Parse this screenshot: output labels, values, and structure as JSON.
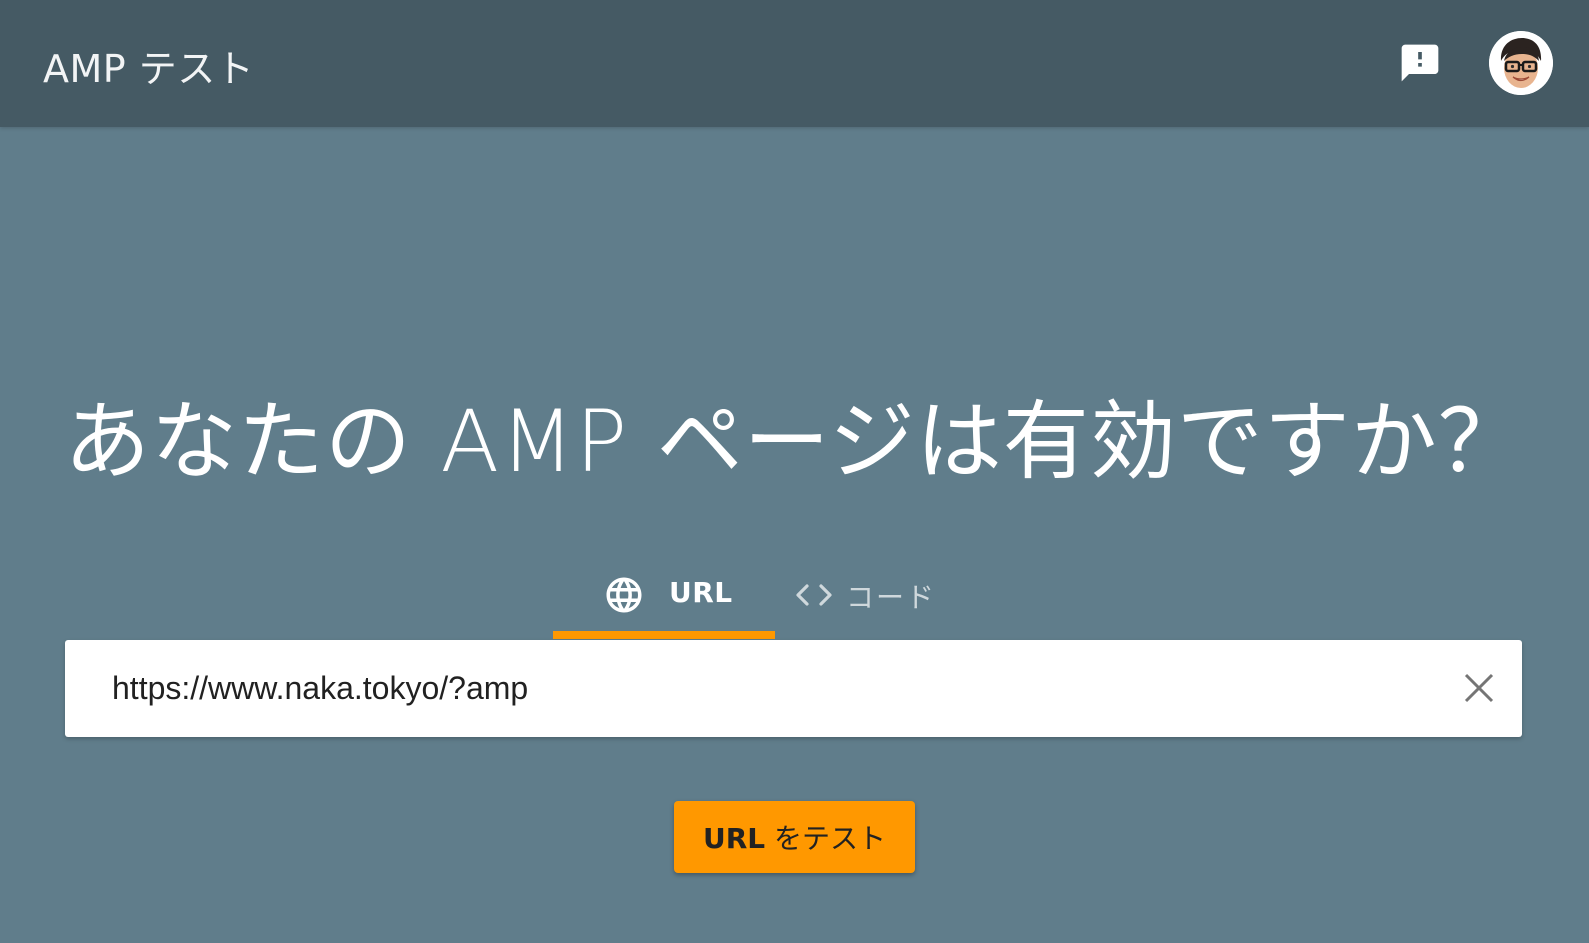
{
  "header": {
    "app_title": "AMP テスト",
    "feedback_icon": "feedback-icon",
    "avatar_icon": "user-avatar"
  },
  "main": {
    "headline": "あなたの AMP ページは有効ですか？",
    "tabs": [
      {
        "label": "URL",
        "icon": "globe-icon",
        "selected": true
      },
      {
        "label": "コード",
        "icon": "code-icon",
        "selected": false
      }
    ],
    "url_input": {
      "value": "https://www.naka.tokyo/?amp",
      "clear_icon": "close-icon"
    },
    "submit_button": {
      "label_bold": "URL",
      "label_rest": " をテスト"
    }
  },
  "colors": {
    "background": "#607d8b",
    "header": "#455a64",
    "accent": "#ff9800",
    "input_bg": "#ffffff"
  }
}
